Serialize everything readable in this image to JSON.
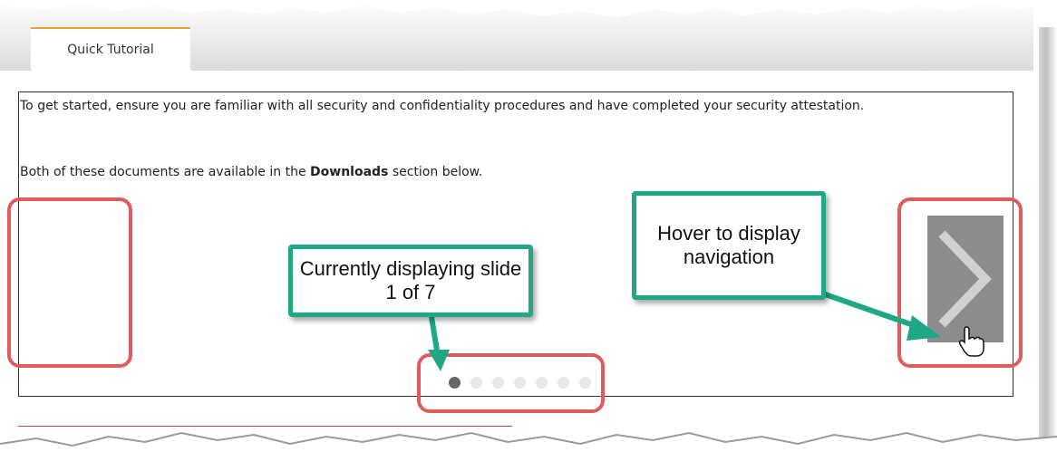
{
  "tab": {
    "label": "Quick Tutorial"
  },
  "slide": {
    "text_line1": "To get started, ensure you are familiar with all security and confidentiality procedures and have completed your security attestation.",
    "text_line2_pre": "Both of these documents are available in the ",
    "text_line2_bold": "Downloads",
    "text_line2_post": " section below."
  },
  "pagination": {
    "current": 1,
    "total": 7
  },
  "annotations": {
    "hover_note": "Hover to display navigation",
    "slide_note": "Currently displaying slide 1 of 7"
  },
  "icons": {
    "next": "chevron-right-icon",
    "cursor": "hand-pointer-icon"
  },
  "colors": {
    "tab_accent": "#f0a030",
    "callout_outline": "#e05b5b",
    "note_border": "#1fa886",
    "nav_background": "#8c8c8c",
    "dot_active": "#666666",
    "dot_inactive": "#e8e8e8"
  }
}
